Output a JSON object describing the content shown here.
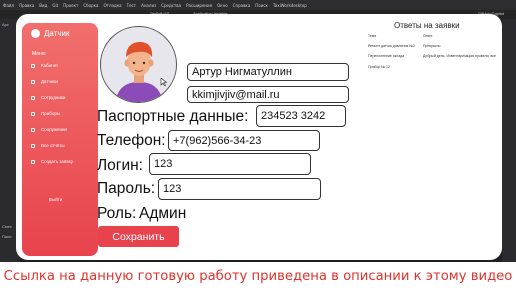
{
  "ide": {
    "menu": [
      "Файл",
      "Правка",
      "Вид",
      "Git",
      "Проект",
      "Сборка",
      "Отладка",
      "Тест",
      "Анализ",
      "Средства",
      "Расширения",
      "Окно",
      "Справка"
    ],
    "search": "Поиск",
    "solution": "TaxiWorkdesktop",
    "toolbar_left": "Любой ЦП",
    "toolbar_mid": "Application Insights",
    "toolbar_right": "GitHub Copilot",
    "left_label": "Арс",
    "left_label2": "Смес",
    "left_label3": "Пани"
  },
  "app": {
    "brand": "Датчик",
    "menu_title": "Меню",
    "nav": [
      "Кабинет",
      "Датчики",
      "Сотрудники",
      "Приборы",
      "Сооружения",
      "Все отчёты",
      "Создать заявку"
    ],
    "exit": "Выйти",
    "profile": {
      "name": "Артур Нигматуллин",
      "email": "kkimjivjiv@mail.ru",
      "passport_label": "Паспортные данные:",
      "passport": "234523 3242",
      "phone_label": "Телефон:",
      "phone": "+7(962)566-34-23",
      "login_label": "Логин:",
      "login": "123",
      "password_label": "Пароль:",
      "password": "123",
      "role_label": "Роль:",
      "role": "Админ"
    },
    "save_label": "Сохранить",
    "answers": {
      "title": "Ответы на заявки",
      "columns": [
        "Тема",
        "Ответ"
      ],
      "rows": [
        [
          "Ремонт датчик давления №2",
          "Прекрасно"
        ],
        [
          "Переполнение склада",
          "Добрый день, Инвентаризацию провели, все"
        ],
        [
          "Прибор № 12",
          ""
        ]
      ]
    }
  },
  "caption": "Ссылка на данную готовую работу приведена в описании к этому видео",
  "colors": {
    "accent": "#e8434d",
    "accent_light": "#f16f6c",
    "caption": "#e1322c",
    "ide_bg": "#1f1f23"
  },
  "icons": [
    "logo-circle",
    "nav-icon",
    "avatar-person",
    "mouse-cursor-icon"
  ]
}
